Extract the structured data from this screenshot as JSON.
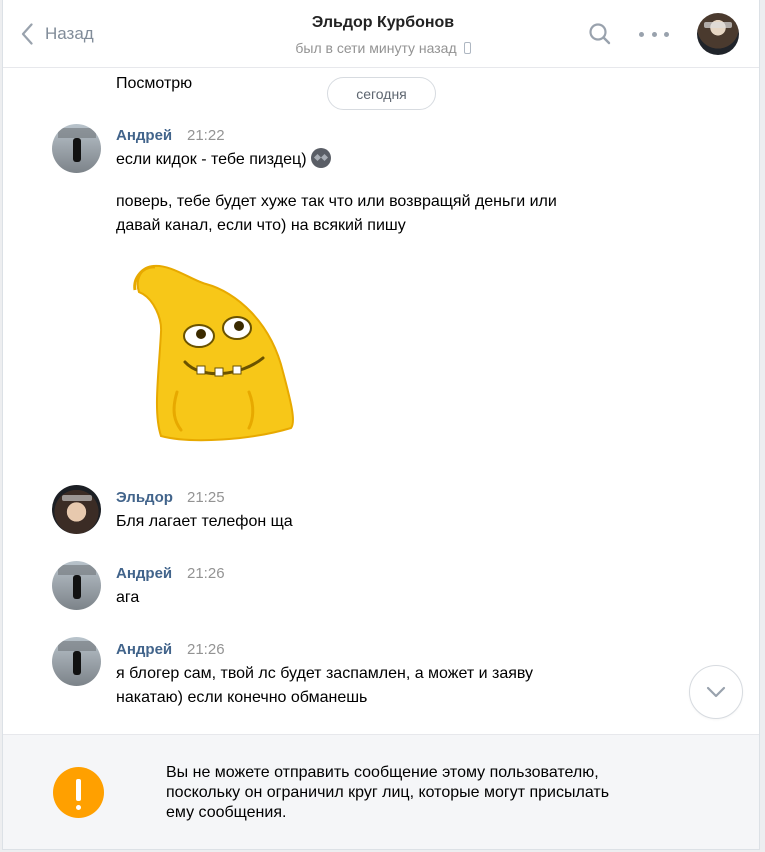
{
  "header": {
    "back_label": "Назад",
    "title": "Эльдор Курбонов",
    "status": "был в сети минуту назад"
  },
  "messages": {
    "prev_tail": "Посмотрю",
    "date_divider": "сегодня",
    "m1": {
      "sender": "Андрей",
      "time": "21:22",
      "line1": "если кидок - тебе пиздец)",
      "line2": "поверь, тебе будет хуже так что или возвращяй деньги или",
      "line3": "давай канал, если что) на всякий пишу"
    },
    "m2": {
      "sender": "Эльдор",
      "time": "21:25",
      "text": "Бля лагает телефон ща"
    },
    "m3": {
      "sender": "Андрей",
      "time": "21:26",
      "text": "ага"
    },
    "m4": {
      "sender": "Андрей",
      "time": "21:26",
      "line1": "я блогер сам, твой лс будет заспамлен, а может и заяву",
      "line2": "накатаю) если конечно обманешь"
    }
  },
  "footer": {
    "line1": "Вы не можете отправить сообщение этому пользователю,",
    "line2": "поскольку он ограничил круг лиц, которые могут присылать",
    "line3": "ему сообщения."
  },
  "colors": {
    "accent": "#42648b",
    "warning": "#ffa000"
  },
  "icons": [
    "chevron-left-icon",
    "phone-icon",
    "search-icon",
    "more-icon",
    "emoji-icon",
    "chevron-down-icon",
    "warning-icon"
  ]
}
